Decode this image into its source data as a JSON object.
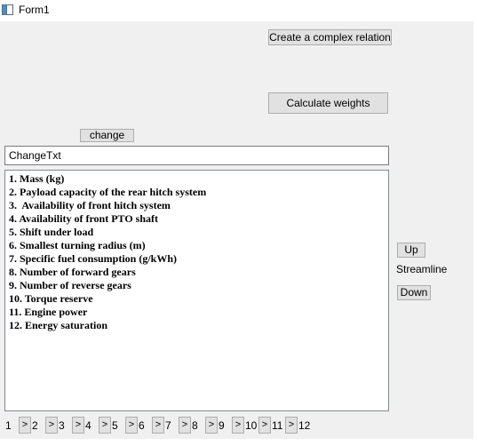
{
  "window": {
    "title": "Form1"
  },
  "buttons": {
    "complex_relation": "Create a complex relation",
    "calculate_weights": "Calculate weights",
    "change": "change",
    "up": "Up",
    "down": "Down"
  },
  "labels": {
    "streamline": "Streamline"
  },
  "change_field": {
    "value": "ChangeTxt"
  },
  "criteria": [
    "1. Mass (kg)",
    "2. Payload capacity of the rear hitch system",
    "3.  Availability of front hitch system",
    "4. Availability of front PTO shaft",
    "5. Shift under load",
    "6. Smallest turning radius (m)",
    "7. Specific fuel consumption (g/kWh)",
    "8. Number of forward gears",
    "9. Number of reverse gears",
    "10. Torque reserve",
    "11. Engine power",
    "12. Energy saturation"
  ],
  "nav": {
    "arrow": ">",
    "numbers": [
      "1",
      "2",
      "3",
      "4",
      "5",
      "6",
      "7",
      "8",
      "9",
      "10",
      "11",
      "12"
    ]
  }
}
